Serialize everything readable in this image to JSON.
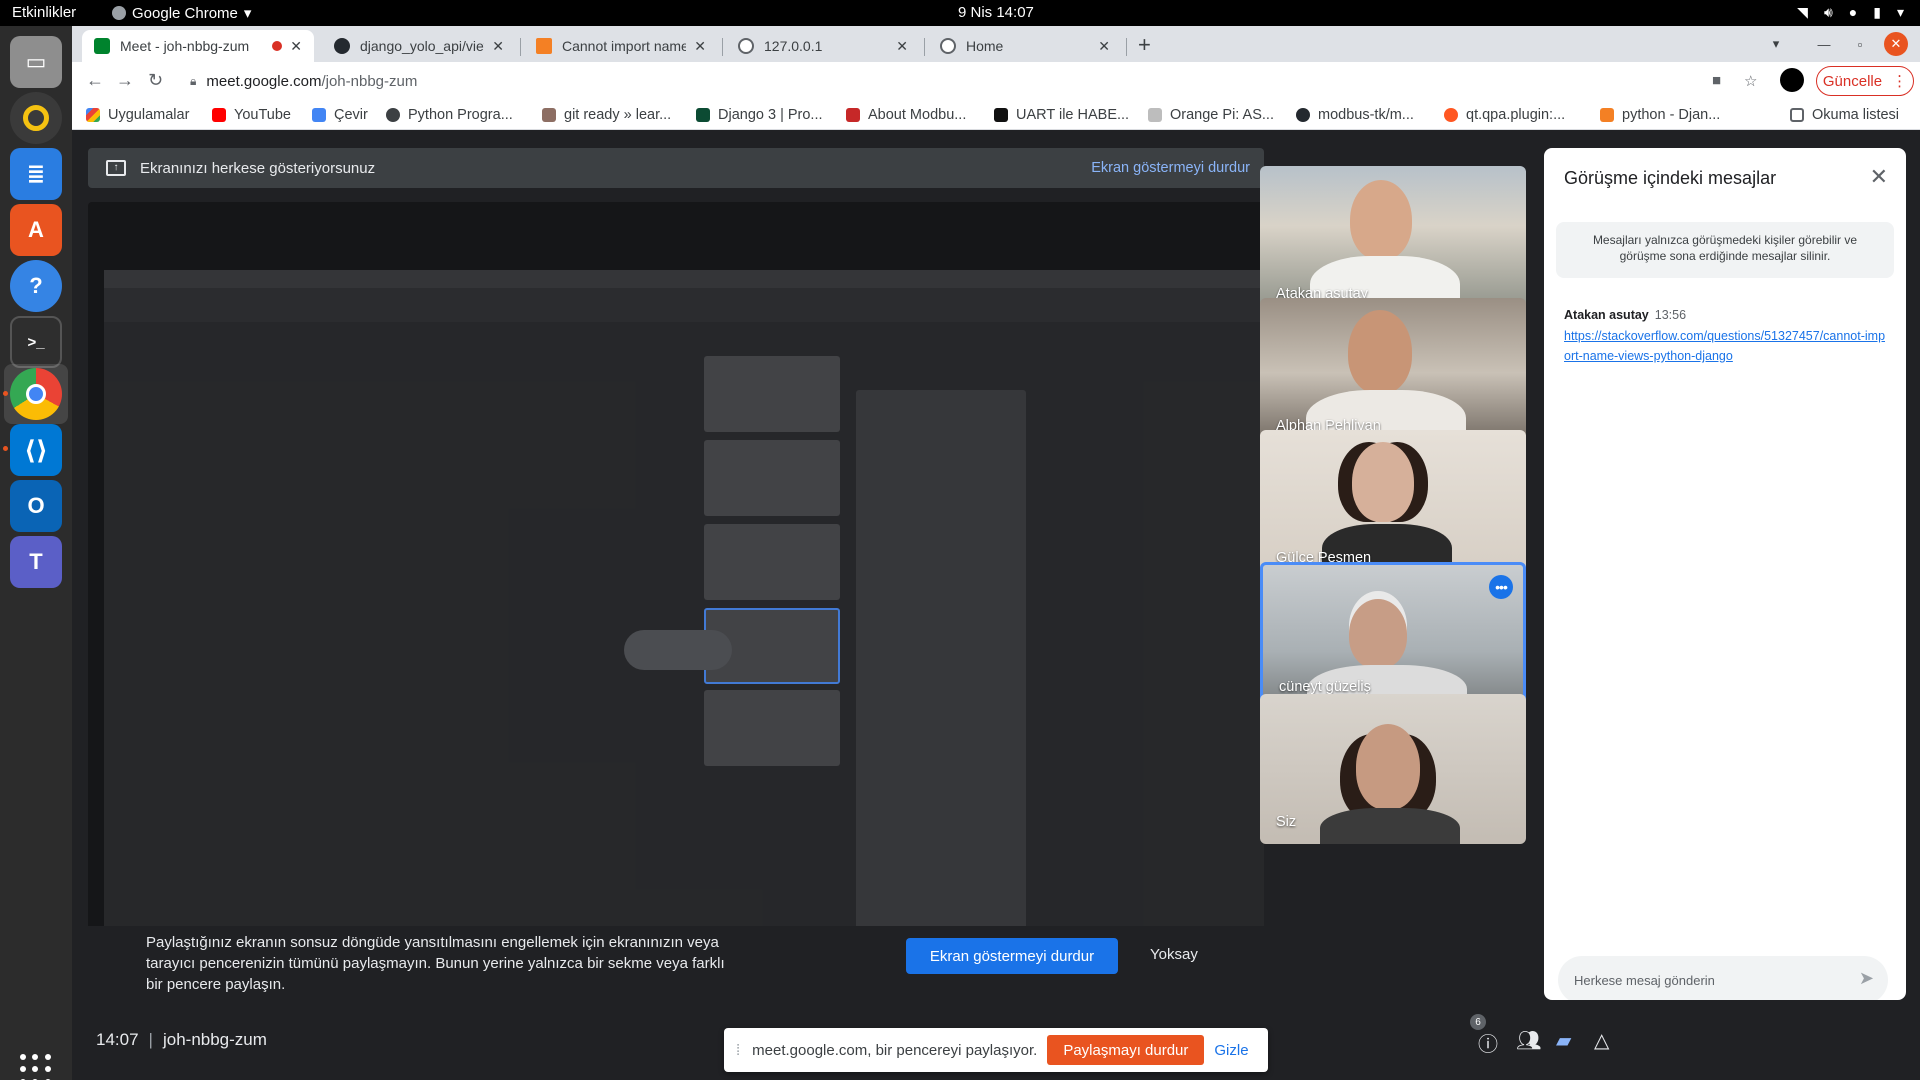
{
  "system": {
    "activities": "Etkinlikler",
    "app_name": "Google Chrome",
    "clock": "9 Nis  14:07"
  },
  "browser": {
    "tabs": [
      {
        "title": "Meet - joh-nbbg-zum",
        "active": true
      },
      {
        "title": "django_yolo_api/views.py"
      },
      {
        "title": "Cannot import name 'views'"
      },
      {
        "title": "127.0.0.1"
      },
      {
        "title": "Home"
      }
    ],
    "url_host": "meet.google.com",
    "url_path": "/joh-nbbg-zum",
    "update_label": "Güncelle",
    "bookmarks": [
      "Uygulamalar",
      "YouTube",
      "Çevir",
      "Python Progra...",
      "git ready » lear...",
      "Django 3 | Pro...",
      "About Modbu...",
      "UART ile HABE...",
      "Orange Pi: AS...",
      "modbus-tk/m...",
      "qt.qpa.plugin:...",
      "python - Djan..."
    ],
    "reading_list": "Okuma listesi"
  },
  "meet": {
    "banner_text": "Ekranınızı herkese gösteriyorsunuz",
    "banner_stop": "Ekran göstermeyi durdur",
    "warning_text": "Paylaştığınız ekranın sonsuz döngüde yansıtılmasını engellemek için ekranınızın veya tarayıcı pencerenizin tümünü paylaşmayın. Bunun yerine yalnızca bir sekme veya farklı bir pencere paylaşın.",
    "warning_stop": "Ekran göstermeyi durdur",
    "warning_ignore": "Yoksay",
    "participants": [
      {
        "name": "Atakan asutay"
      },
      {
        "name": "Alphan Pehlivan"
      },
      {
        "name": "Gülce Peşmen"
      },
      {
        "name": "cüneyt güzeliş"
      },
      {
        "name": "Siz"
      }
    ],
    "time": "14:07",
    "meeting_code": "joh-nbbg-zum",
    "participant_count": "6"
  },
  "chat": {
    "title": "Görüşme içindeki mesajlar",
    "notice": "Mesajları yalnızca görüşmedeki kişiler görebilir ve görüşme sona erdiğinde mesajlar silinir.",
    "messages": [
      {
        "sender": "Atakan asutay",
        "time": "13:56",
        "text": "https://stackoverflow.com/questions/51327457/cannot-import-name-views-python-django"
      }
    ],
    "input_placeholder": "Herkese mesaj gönderin"
  },
  "share_notification": {
    "text": "meet.google.com, bir pencereyi paylaşıyor.",
    "stop": "Paylaşmayı durdur",
    "hide": "Gizle"
  }
}
